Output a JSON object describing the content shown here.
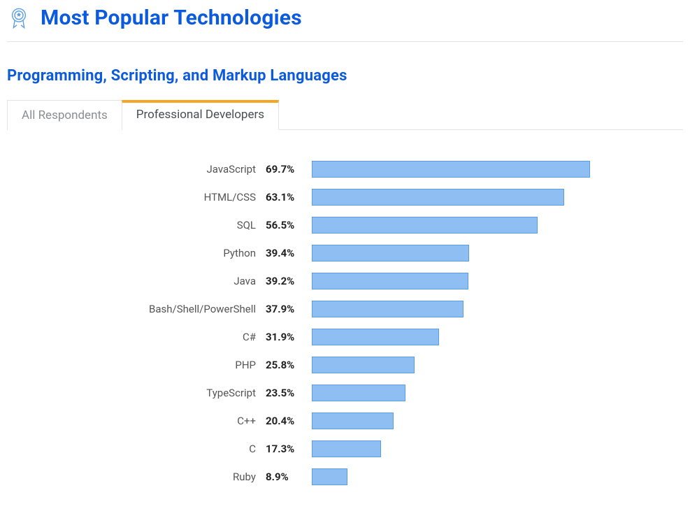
{
  "header": {
    "title": "Most Popular Technologies"
  },
  "section": {
    "subtitle": "Programming, Scripting, and Markup Languages"
  },
  "tabs": [
    {
      "label": "All Respondents",
      "active": false
    },
    {
      "label": "Professional Developers",
      "active": true
    }
  ],
  "chart_data": {
    "type": "bar",
    "orientation": "horizontal",
    "max": 70,
    "title": "Programming, Scripting, and Markup Languages",
    "series": [
      {
        "name": "Professional Developers",
        "items": [
          {
            "label": "JavaScript",
            "value": 69.7
          },
          {
            "label": "HTML/CSS",
            "value": 63.1
          },
          {
            "label": "SQL",
            "value": 56.5
          },
          {
            "label": "Python",
            "value": 39.4
          },
          {
            "label": "Java",
            "value": 39.2
          },
          {
            "label": "Bash/Shell/PowerShell",
            "value": 37.9
          },
          {
            "label": "C#",
            "value": 31.9
          },
          {
            "label": "PHP",
            "value": 25.8
          },
          {
            "label": "TypeScript",
            "value": 23.5
          },
          {
            "label": "C++",
            "value": 20.4
          },
          {
            "label": "C",
            "value": 17.3
          },
          {
            "label": "Ruby",
            "value": 8.9
          }
        ]
      }
    ]
  }
}
